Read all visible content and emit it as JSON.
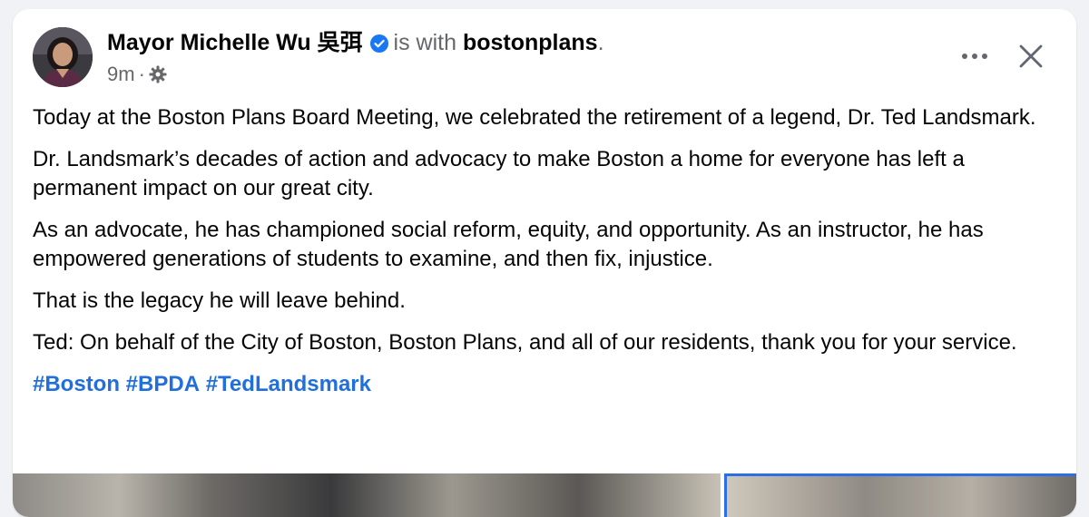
{
  "post": {
    "author": "Mayor Michelle Wu 吳弭",
    "with_text": "is with",
    "tagged": "bostonplans",
    "period": ".",
    "time": "9m",
    "separator": "·",
    "paragraphs": [
      "Today at the Boston Plans Board Meeting, we celebrated the retirement of a legend, Dr. Ted Landsmark.",
      "Dr. Landsmark’s decades of action and advocacy to make Boston a home for everyone has left a permanent impact on our great city.",
      "As an advocate, he has championed social reform, equity, and opportunity. As an instructor, he has empowered generations of students to examine, and then fix, injustice.",
      "That is the legacy he will leave behind.",
      "Ted: On behalf of the City of Boston, Boston Plans, and all of our residents, thank you for your service."
    ],
    "hashtags": [
      "#Boston",
      "#BPDA",
      "#TedLandsmark"
    ]
  },
  "icons": {
    "verified": "verified-badge-icon",
    "audience": "gear-icon",
    "more": "more-horizontal-icon",
    "close": "close-icon"
  },
  "colors": {
    "link": "#216fdb",
    "verified": "#1877f2",
    "secondary_text": "#65676b",
    "background": "#f0f2f5"
  }
}
